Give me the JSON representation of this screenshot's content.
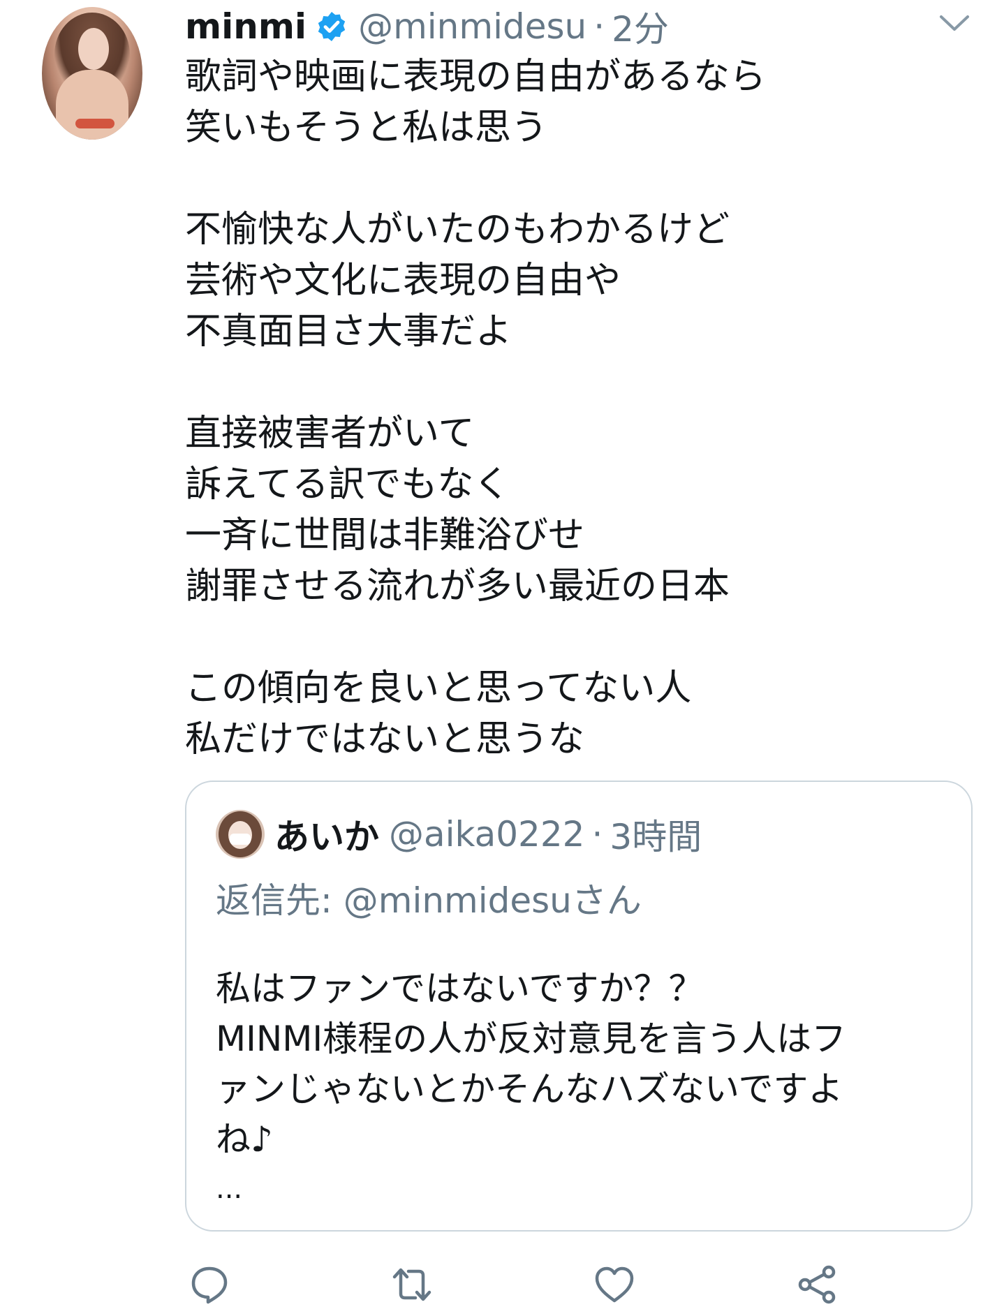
{
  "tweet": {
    "author_name": "minmi",
    "handle": "@minmidesu",
    "separator": "·",
    "time": "2分",
    "lines": [
      "歌詞や映画に表現の自由があるなら",
      "笑いもそうと私は思う",
      "",
      "不愉快な人がいたのもわかるけど",
      "芸術や文化に表現の自由や",
      "不真面目さ大事だよ",
      "",
      "直接被害者がいて",
      "訴えてる訳でもなく",
      "一斉に世間は非難浴びせ",
      "謝罪させる流れが多い最近の日本",
      "",
      "この傾向を良いと思ってない人",
      "私だけではないと思うな"
    ]
  },
  "quoted": {
    "author_name": "あいか",
    "handle": "@aika0222",
    "separator": "·",
    "time": "3時間",
    "reply_to": "返信先: @minmidesuさん",
    "lines": [
      "私はファンではないですか？？",
      "MINMI様程の人が反対意見を言う人はフ",
      "ァンじゃないとかそんなハズないですよ",
      "ね♪"
    ],
    "more": "..."
  },
  "icons": {
    "verified": "verified-badge-icon",
    "caret": "chevron-down-icon",
    "reply": "reply-icon",
    "retweet": "retweet-icon",
    "like": "heart-icon",
    "share": "share-icon"
  },
  "colors": {
    "text": "#14171a",
    "secondary": "#657786",
    "verified_blue": "#1da1f2",
    "border": "#ccd6dd"
  }
}
